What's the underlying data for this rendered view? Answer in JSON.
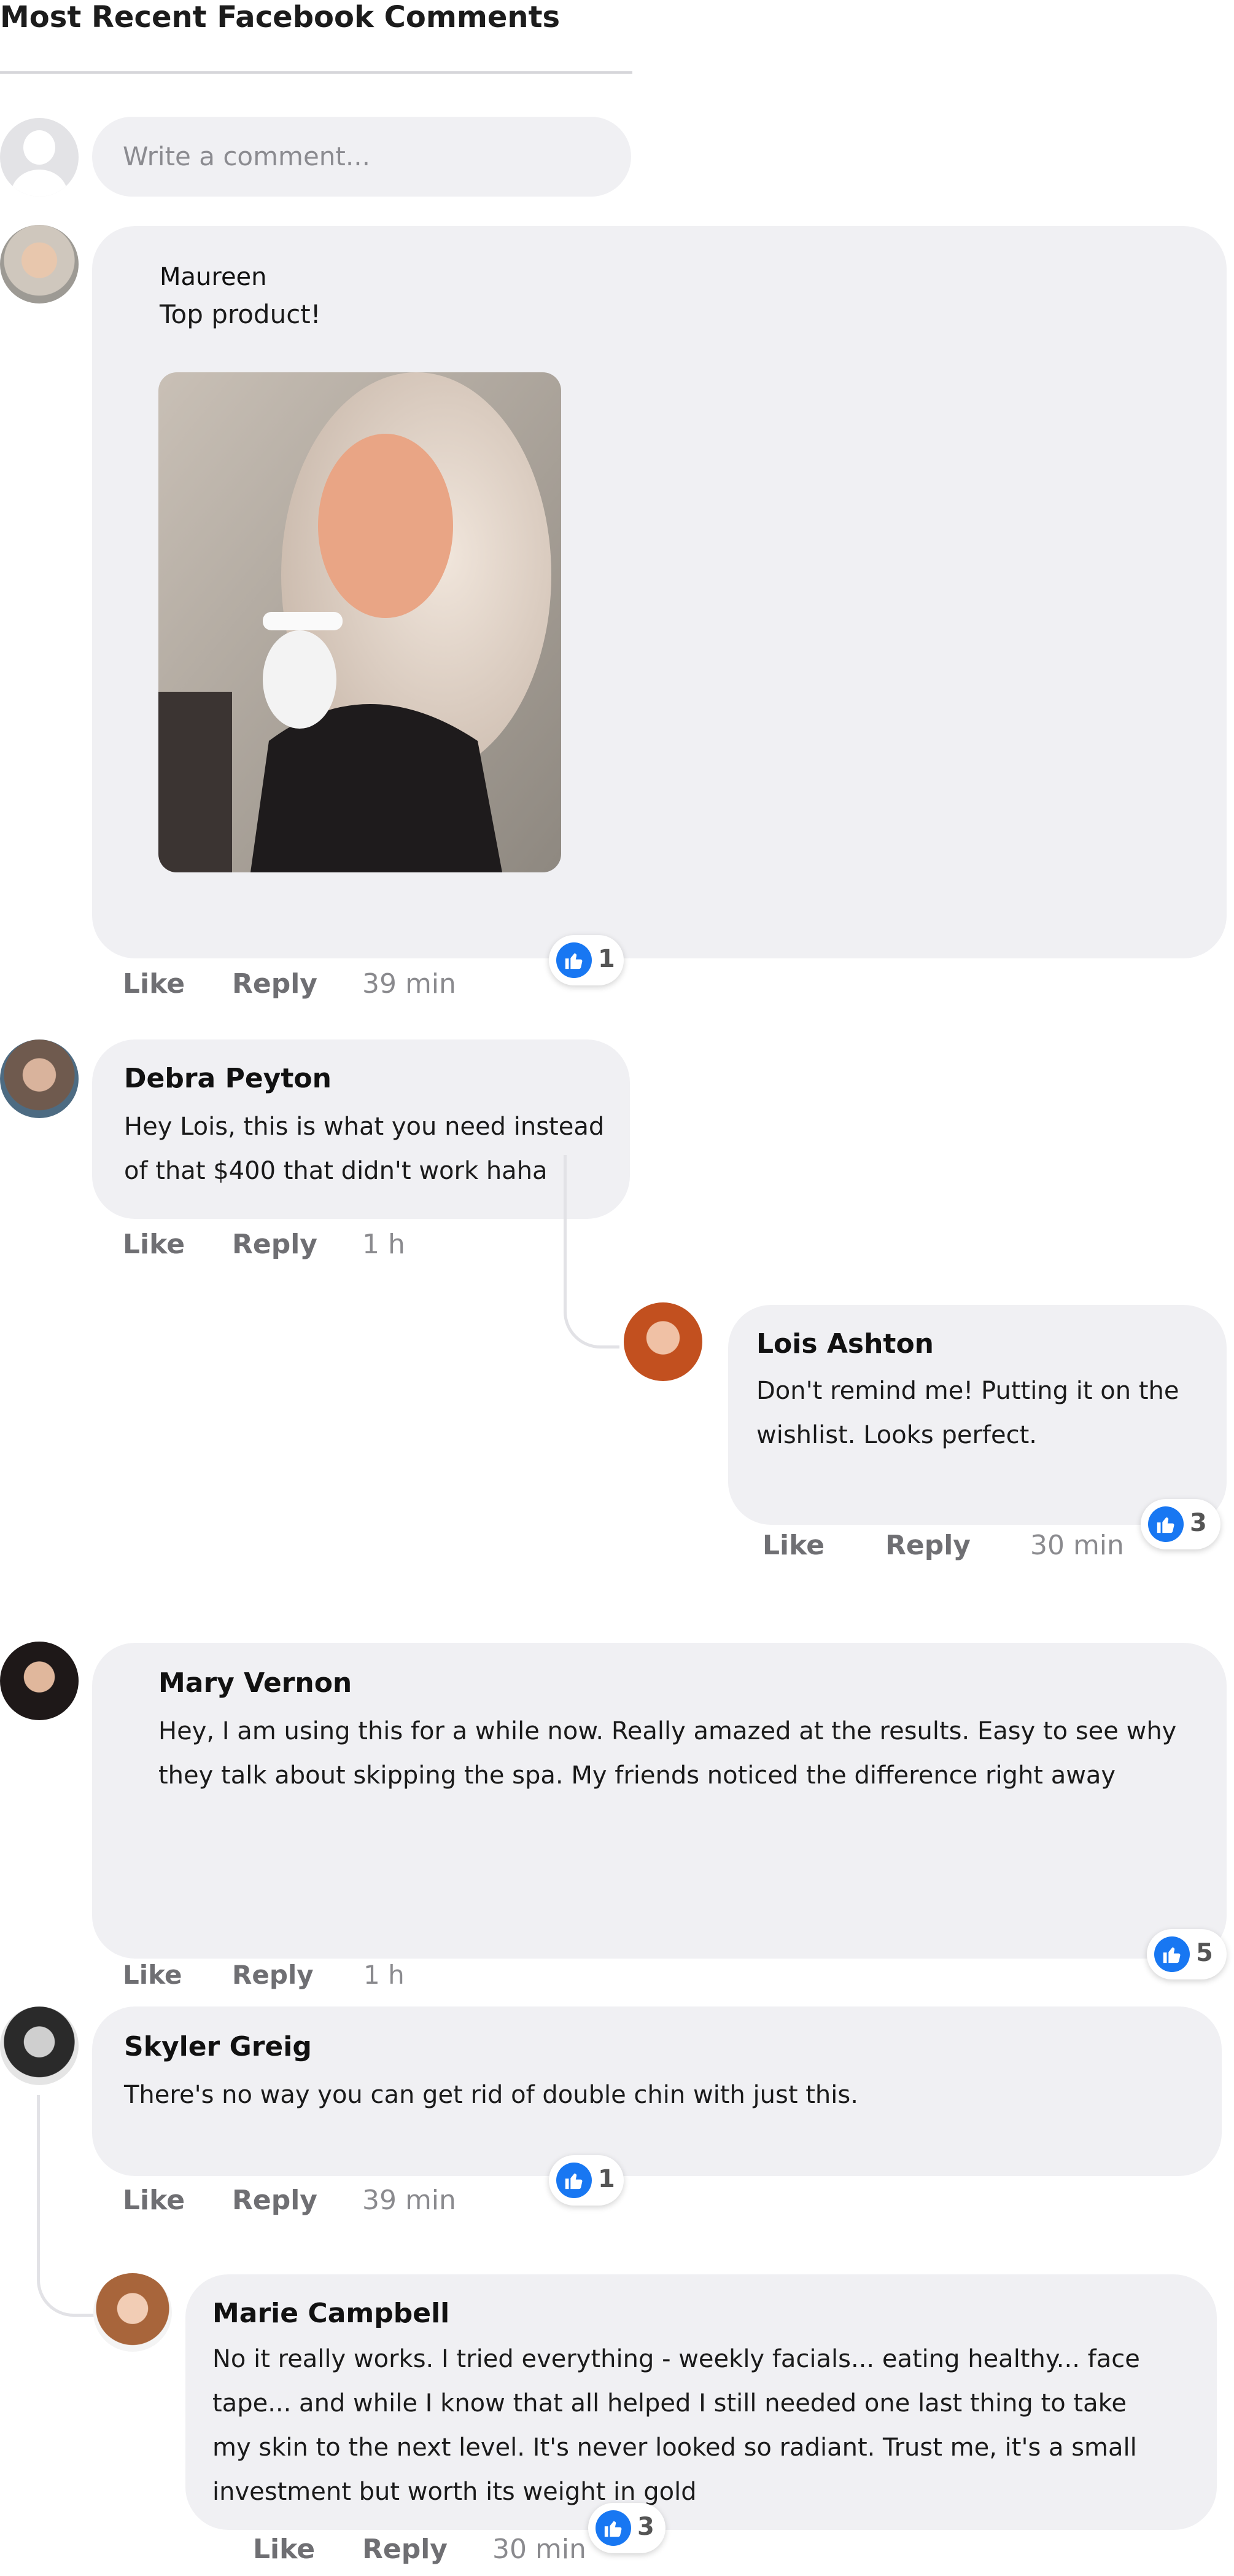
{
  "header": {
    "title": "Most Recent Facebook Comments"
  },
  "composer": {
    "placeholder": "Write a comment..."
  },
  "labels": {
    "like": "Like",
    "reply": "Reply"
  },
  "comments": [
    {
      "name": "Maureen",
      "text": "Top product!",
      "time": "39 min",
      "reactions": "1",
      "has_photo": true
    },
    {
      "name": "Debra Peyton",
      "text": "Hey Lois, this is what you need instead of that $400 that didn't work haha",
      "time": "1 h"
    },
    {
      "name": "Lois Ashton",
      "text": "Don't remind me! Putting it on the wishlist. Looks perfect.",
      "time": "30 min",
      "reactions": "3"
    },
    {
      "name": "Mary Vernon",
      "text": "Hey, I am using this for a while now. Really amazed at the results. Easy to see why they talk about skipping the spa. My friends noticed the difference right away",
      "time": "1 h",
      "reactions": "5"
    },
    {
      "name": "Skyler Greig",
      "text": "There's no way you can get rid of double chin with just this.",
      "time": "39 min",
      "reactions": "1"
    },
    {
      "name": "Marie Campbell",
      "text": "No it really works. I tried everything - weekly facials... eating healthy... face tape... and while I know that all helped I still needed one last thing to take my skin to the next level. It's never looked so radiant. Trust me, it's a small investment but worth its weight in gold",
      "time": "30 min",
      "reactions": "3"
    }
  ],
  "colors": {
    "bubble": "#f0f0f3",
    "like_blue": "#1877f2",
    "muted": "#8a8a8e"
  },
  "icons": {
    "reaction": "thumbs-up-icon",
    "default_avatar": "user-silhouette-icon"
  }
}
